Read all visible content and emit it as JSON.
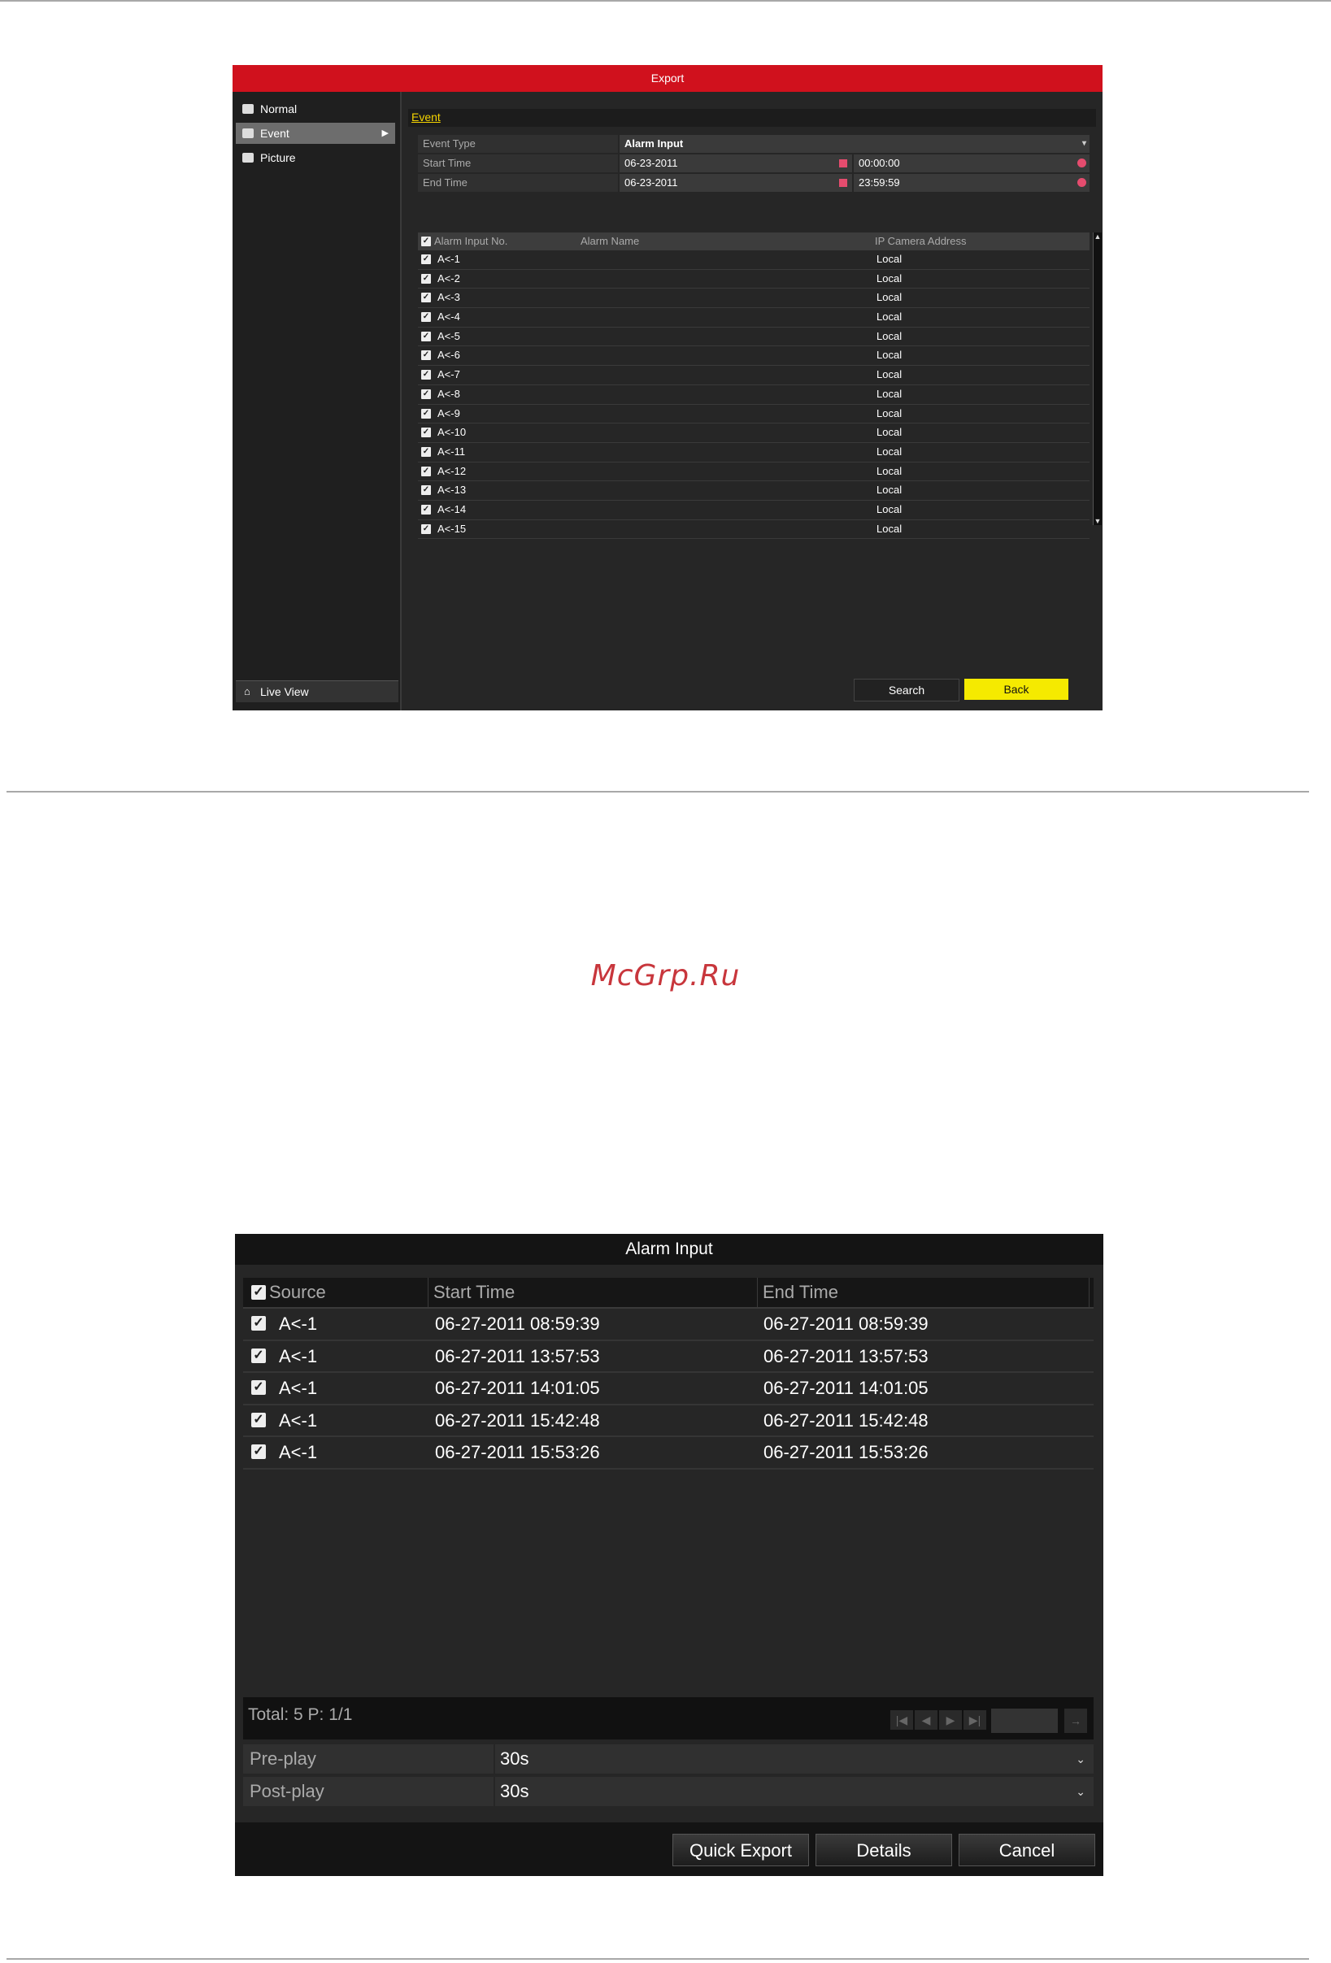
{
  "export_screen": {
    "title": "Export",
    "sidebar": [
      {
        "label": "Normal",
        "icon": "folder-icon"
      },
      {
        "label": "Event",
        "icon": "event-icon",
        "active": true
      },
      {
        "label": "Picture",
        "icon": "picture-icon"
      }
    ],
    "live_view": "Live View",
    "tab": "Event",
    "fields": {
      "event_type_label": "Event Type",
      "event_type_value": "Alarm Input",
      "start_time_label": "Start Time",
      "start_date": "06-23-2011",
      "start_time": "00:00:00",
      "end_time_label": "End Time",
      "end_date": "06-23-2011",
      "end_time": "23:59:59"
    },
    "table": {
      "headers": [
        "Alarm Input No.",
        "Alarm Name",
        "IP Camera Address"
      ],
      "rows": [
        {
          "no": "A<-1",
          "name": "",
          "address": "Local"
        },
        {
          "no": "A<-2",
          "name": "",
          "address": "Local"
        },
        {
          "no": "A<-3",
          "name": "",
          "address": "Local"
        },
        {
          "no": "A<-4",
          "name": "",
          "address": "Local"
        },
        {
          "no": "A<-5",
          "name": "",
          "address": "Local"
        },
        {
          "no": "A<-6",
          "name": "",
          "address": "Local"
        },
        {
          "no": "A<-7",
          "name": "",
          "address": "Local"
        },
        {
          "no": "A<-8",
          "name": "",
          "address": "Local"
        },
        {
          "no": "A<-9",
          "name": "",
          "address": "Local"
        },
        {
          "no": "A<-10",
          "name": "",
          "address": "Local"
        },
        {
          "no": "A<-11",
          "name": "",
          "address": "Local"
        },
        {
          "no": "A<-12",
          "name": "",
          "address": "Local"
        },
        {
          "no": "A<-13",
          "name": "",
          "address": "Local"
        },
        {
          "no": "A<-14",
          "name": "",
          "address": "Local"
        },
        {
          "no": "A<-15",
          "name": "",
          "address": "Local"
        }
      ]
    },
    "buttons": {
      "search": "Search",
      "back": "Back"
    },
    "colors": {
      "title_bar": "#d0111d",
      "back_button": "#f5ea00",
      "tab_text": "#f5d400"
    }
  },
  "watermark": "McGrp.Ru",
  "alarm_screen": {
    "title": "Alarm Input",
    "table": {
      "headers": [
        "Source",
        "Start Time",
        "End Time"
      ],
      "rows": [
        {
          "source": "A<-1",
          "start": "06-27-2011 08:59:39",
          "end": "06-27-2011 08:59:39"
        },
        {
          "source": "A<-1",
          "start": "06-27-2011 13:57:53",
          "end": "06-27-2011 13:57:53"
        },
        {
          "source": "A<-1",
          "start": "06-27-2011 14:01:05",
          "end": "06-27-2011 14:01:05"
        },
        {
          "source": "A<-1",
          "start": "06-27-2011 15:42:48",
          "end": "06-27-2011 15:42:48"
        },
        {
          "source": "A<-1",
          "start": "06-27-2011 15:53:26",
          "end": "06-27-2011 15:53:26"
        }
      ]
    },
    "pager": {
      "total": "Total: 5  P: 1/1"
    },
    "settings": [
      {
        "label": "Pre-play",
        "value": "30s"
      },
      {
        "label": "Post-play",
        "value": "30s"
      }
    ],
    "buttons": {
      "quick_export": "Quick Export",
      "details": "Details",
      "cancel": "Cancel"
    }
  }
}
